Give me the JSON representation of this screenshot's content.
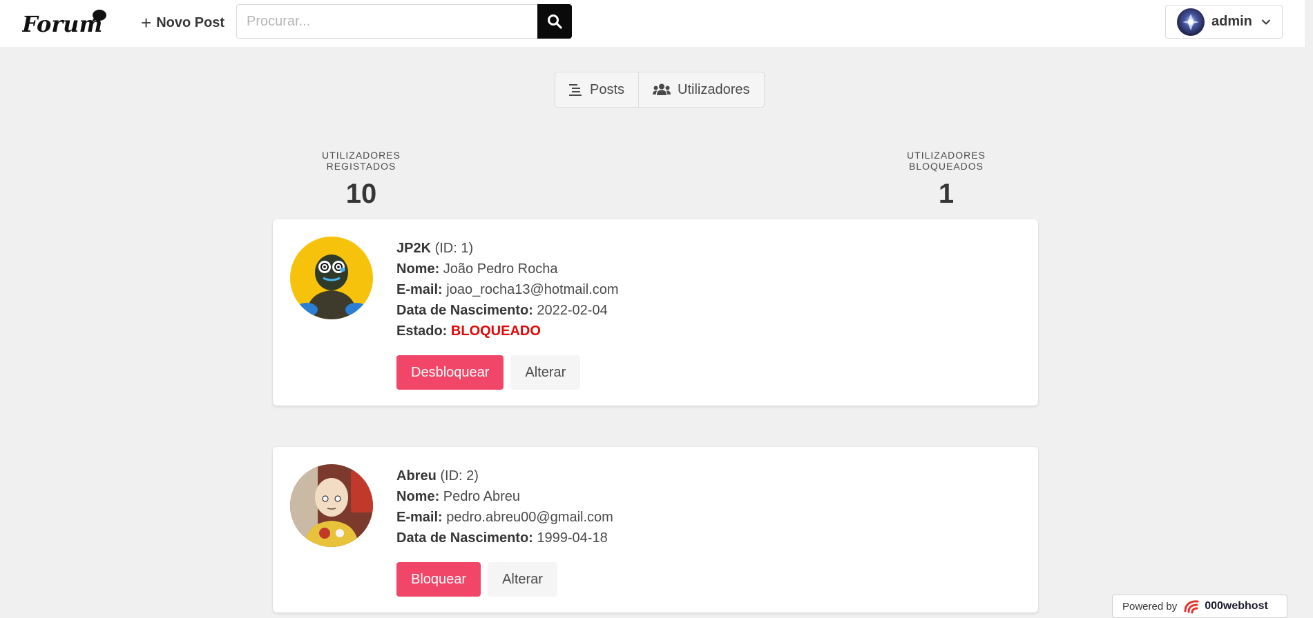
{
  "brand": {
    "logo_text": "Forum"
  },
  "navbar": {
    "new_post_label": "Novo Post",
    "search_placeholder": "Procurar...",
    "user_name": "admin"
  },
  "tabs": [
    {
      "label": "Posts",
      "icon": "list-icon"
    },
    {
      "label": "Utilizadores",
      "icon": "users-icon"
    }
  ],
  "stats": {
    "registered": {
      "label": "Utilizadores Registados",
      "value": "10"
    },
    "blocked": {
      "label": "Utilizadores Bloqueados",
      "value": "1"
    }
  },
  "users": [
    {
      "username": "JP2K",
      "id_text": "(ID: 1)",
      "name_label": "Nome:",
      "name": "João Pedro Rocha",
      "email_label": "E-mail:",
      "email": "joao_rocha13@hotmail.com",
      "birth_label": "Data de Nascimento:",
      "birth": "2022-02-04",
      "status_label": "Estado:",
      "status": "BLOQUEADO",
      "primary_action": "Desbloquear",
      "secondary_action": "Alterar"
    },
    {
      "username": "Abreu",
      "id_text": "(ID: 2)",
      "name_label": "Nome:",
      "name": "Pedro Abreu",
      "email_label": "E-mail:",
      "email": "pedro.abreu00@gmail.com",
      "birth_label": "Data de Nascimento:",
      "birth": "1999-04-18",
      "primary_action": "Bloquear",
      "secondary_action": "Alterar"
    }
  ],
  "footer": {
    "powered_by": "Powered by",
    "host_brand": "000webhost"
  },
  "colors": {
    "danger": "#f14668",
    "blocked_text": "#e30707",
    "background": "#f0f0f0"
  }
}
